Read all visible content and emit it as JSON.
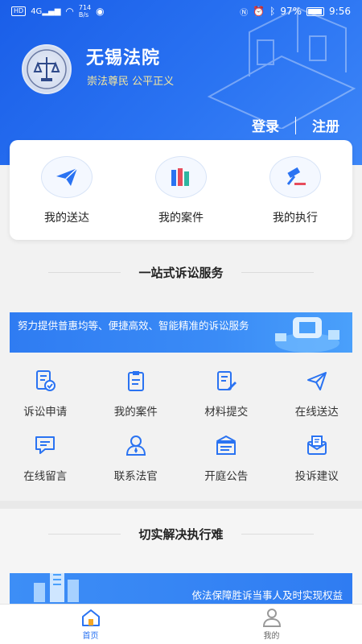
{
  "status_bar": {
    "network_badge": "HD",
    "signal_label": "4G",
    "speed_value": "714",
    "speed_unit": "B/s",
    "battery": "97%",
    "time": "9:56"
  },
  "header": {
    "court_name": "无锡法院",
    "slogan": "崇法尊民 公平正义",
    "login": "登录",
    "register": "注册"
  },
  "quick_actions": [
    {
      "label": "我的送达",
      "icon": "paper-plane-icon"
    },
    {
      "label": "我的案件",
      "icon": "books-icon"
    },
    {
      "label": "我的执行",
      "icon": "gavel-icon"
    }
  ],
  "section1": {
    "title": "一站式诉讼服务",
    "banner_text": "努力提供普惠均等、便捷高效、智能精准的诉讼服务"
  },
  "services": [
    {
      "label": "诉讼申请",
      "icon": "document-check-icon"
    },
    {
      "label": "我的案件",
      "icon": "clipboard-icon"
    },
    {
      "label": "材料提交",
      "icon": "document-edit-icon"
    },
    {
      "label": "在线送达",
      "icon": "send-icon"
    },
    {
      "label": "在线留言",
      "icon": "message-icon"
    },
    {
      "label": "联系法官",
      "icon": "judge-icon"
    },
    {
      "label": "开庭公告",
      "icon": "announcement-icon"
    },
    {
      "label": "投诉建议",
      "icon": "feedback-icon"
    }
  ],
  "section2": {
    "title": "切实解决执行难",
    "banner_text": "依法保障胜诉当事人及时实现权益"
  },
  "bottom_nav": [
    {
      "label": "首页",
      "icon": "home-icon",
      "active": true
    },
    {
      "label": "我的",
      "icon": "user-icon",
      "active": false
    }
  ],
  "colors": {
    "primary": "#2a73f2",
    "slogan": "#f5e79e",
    "icon_blue": "#2a73f2"
  }
}
